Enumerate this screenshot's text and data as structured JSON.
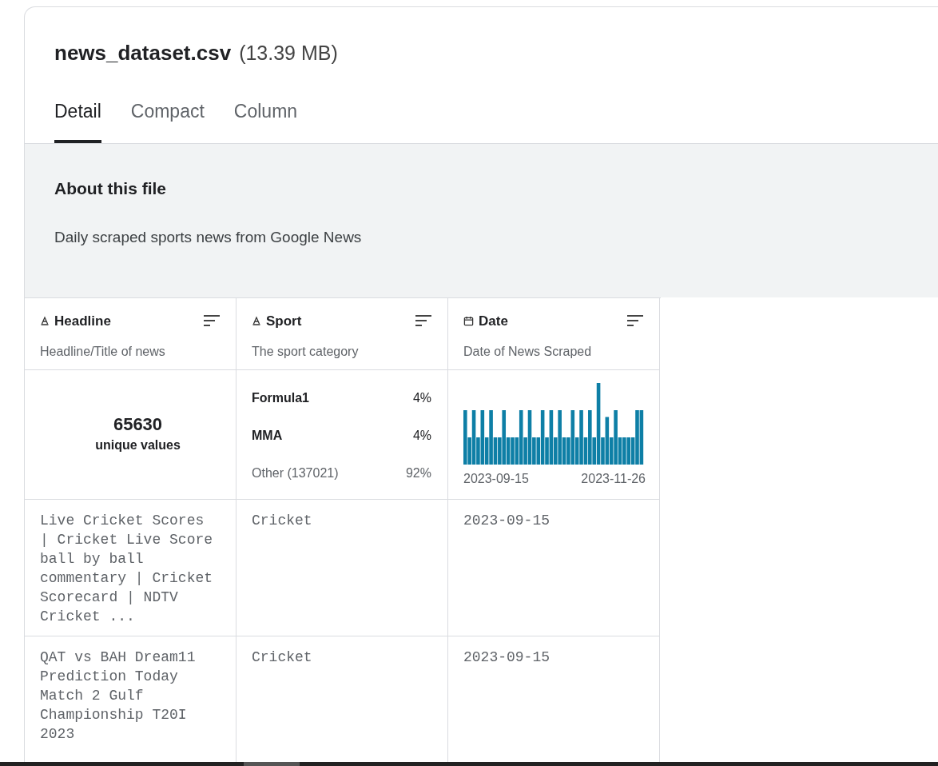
{
  "file": {
    "name": "news_dataset.csv",
    "size": "(13.39 MB)"
  },
  "tabs": [
    {
      "label": "Detail",
      "selected": true
    },
    {
      "label": "Compact",
      "selected": false
    },
    {
      "label": "Column",
      "selected": false
    }
  ],
  "about": {
    "title": "About this file",
    "description": "Daily scraped sports news from Google News"
  },
  "columns": [
    {
      "name": "Headline",
      "kind": "string",
      "description": "Headline/Title of news",
      "summary": {
        "kind": "unique",
        "count": "65630",
        "label": "unique values"
      }
    },
    {
      "name": "Sport",
      "kind": "string",
      "description": "The sport category",
      "summary": {
        "kind": "categories",
        "items": [
          {
            "label": "Formula1",
            "share": "4%",
            "bold": true
          },
          {
            "label": "MMA",
            "share": "4%",
            "bold": true
          },
          {
            "label": "Other (137021)",
            "share": "92%",
            "bold": false
          }
        ]
      }
    },
    {
      "name": "Date",
      "kind": "date",
      "description": "Date of News Scraped",
      "summary": {
        "kind": "histogram",
        "start": "2023-09-15",
        "end": "2023-11-26"
      }
    }
  ],
  "rows": [
    [
      "Live Cricket Scores | Cricket Live Score ball by ball commentary | Cricket Scorecard | NDTV Cricket ...",
      "Cricket",
      "2023-09-15"
    ],
    [
      "QAT vs BAH Dream11 Prediction Today Match 2 Gulf Championship T20I 2023",
      "Cricket",
      "2023-09-15"
    ]
  ]
}
